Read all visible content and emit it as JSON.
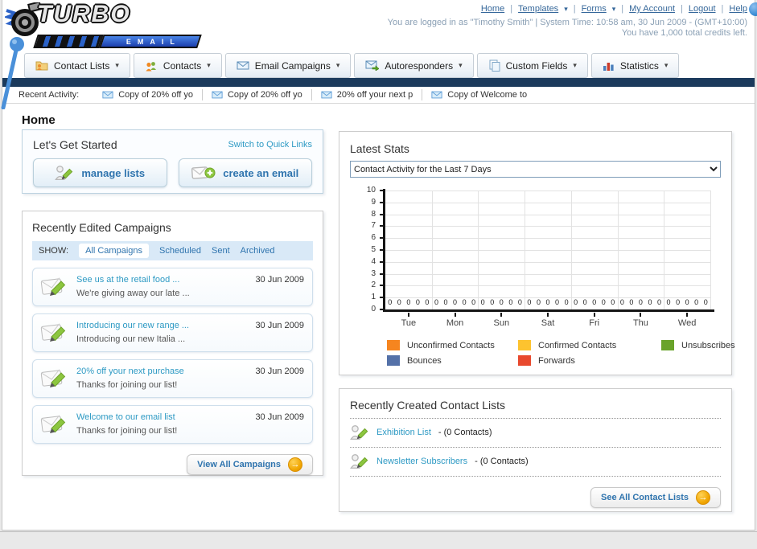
{
  "page": {
    "heading": "Home"
  },
  "header": {
    "logo": {
      "line1": "TURBO",
      "line2": "EMAIL"
    },
    "nav": {
      "separator": "|",
      "items": [
        {
          "label": "Home",
          "dropdown": false
        },
        {
          "label": "Templates",
          "dropdown": true
        },
        {
          "label": "Forms",
          "dropdown": true
        },
        {
          "label": "My Account",
          "dropdown": false
        },
        {
          "label": "Logout",
          "dropdown": false
        },
        {
          "label": "Help",
          "dropdown": false
        }
      ]
    },
    "login_info": "You are logged in as \"Timothy Smith\" | System Time: 10:58 am, 30 Jun 2009 - (GMT+10:00)",
    "credits_info": "You have 1,000 total credits left."
  },
  "main_nav": {
    "tabs": [
      {
        "label": "Contact Lists"
      },
      {
        "label": "Contacts"
      },
      {
        "label": "Email Campaigns"
      },
      {
        "label": "Autoresponders"
      },
      {
        "label": "Custom Fields"
      },
      {
        "label": "Statistics"
      }
    ]
  },
  "recent_activity": {
    "label": "Recent Activity:",
    "items": [
      {
        "text": "Copy of 20% off yo"
      },
      {
        "text": "Copy of 20% off yo"
      },
      {
        "text": "20% off your next p"
      },
      {
        "text": "Copy of Welcome to"
      }
    ]
  },
  "get_started": {
    "title": "Let's Get Started",
    "switch_link": "Switch to Quick Links",
    "buttons": [
      {
        "label": "manage lists"
      },
      {
        "label": "create an email"
      }
    ]
  },
  "campaigns": {
    "title": "Recently Edited Campaigns",
    "filter": {
      "label": "SHOW:",
      "options": [
        "All Campaigns",
        "Scheduled",
        "Sent",
        "Archived"
      ],
      "selected": "All Campaigns"
    },
    "items": [
      {
        "title": "See us at the retail food ...",
        "subtitle": "We're giving away our late ...",
        "date": "30 Jun 2009"
      },
      {
        "title": "Introducing our new range ...",
        "subtitle": "Introducing our new Italia ...",
        "date": "30 Jun 2009"
      },
      {
        "title": "20% off your next purchase",
        "subtitle": "Thanks for joining our list!",
        "date": "30 Jun 2009"
      },
      {
        "title": "Welcome to our email list",
        "subtitle": "Thanks for joining our list!",
        "date": "30 Jun 2009"
      }
    ],
    "view_all_label": "View All Campaigns"
  },
  "stats": {
    "title": "Latest Stats",
    "selected_report": "Contact Activity for the Last 7 Days"
  },
  "chart_data": {
    "type": "bar",
    "title": "Contact Activity for the Last 7 Days",
    "categories": [
      "Tue",
      "Mon",
      "Sun",
      "Sat",
      "Fri",
      "Thu",
      "Wed"
    ],
    "series": [
      {
        "name": "Unconfirmed Contacts",
        "color": "#f6851f",
        "values": [
          0,
          0,
          0,
          0,
          0,
          0,
          0
        ]
      },
      {
        "name": "Confirmed Contacts",
        "color": "#fdc32f",
        "values": [
          0,
          0,
          0,
          0,
          0,
          0,
          0
        ]
      },
      {
        "name": "Unsubscribes",
        "color": "#69a32a",
        "values": [
          0,
          0,
          0,
          0,
          0,
          0,
          0
        ]
      },
      {
        "name": "Bounces",
        "color": "#5471a8",
        "values": [
          0,
          0,
          0,
          0,
          0,
          0,
          0
        ]
      },
      {
        "name": "Forwards",
        "color": "#e8492e",
        "values": [
          0,
          0,
          0,
          0,
          0,
          0,
          0
        ]
      }
    ],
    "ylim": [
      0,
      10
    ],
    "ytick_step": 1,
    "grid": true,
    "legend_position": "bottom",
    "data_labels_shown": true
  },
  "contact_lists": {
    "title": "Recently Created Contact Lists",
    "items": [
      {
        "name": "Exhibition List",
        "count": "- (0 Contacts)"
      },
      {
        "name": "Newsletter Subscribers",
        "count": "- (0 Contacts)"
      }
    ],
    "see_all_label": "See All Contact Lists"
  },
  "colors": {
    "navy_bar": "#1b3a5c",
    "link_blue": "#35679a",
    "light_blue_link": "#2e9ac4",
    "button_text_blue": "#2f74ae",
    "accent_orange": "#f0a500",
    "filter_bar_bg": "#d9e9f7"
  }
}
